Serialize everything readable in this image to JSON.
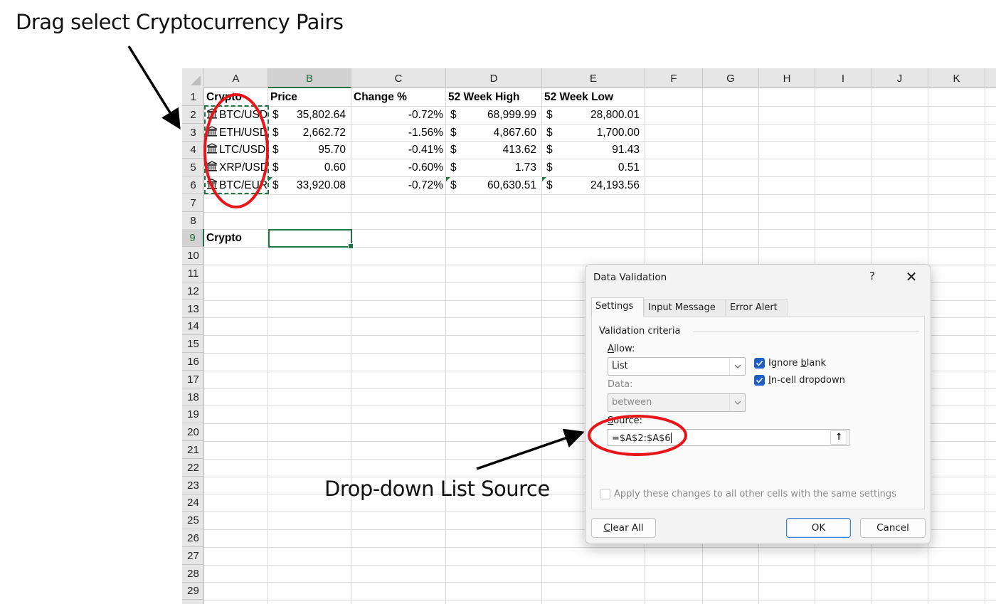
{
  "annotations": {
    "drag_select": "Drag select Cryptocurrency Pairs",
    "dropdown_source": "Drop-down List Source",
    "highlight_color": "#e8161b",
    "arrow_color": "#000000"
  },
  "sheet": {
    "columns": [
      "A",
      "B",
      "C",
      "D",
      "E",
      "F",
      "G",
      "H",
      "I",
      "J",
      "K"
    ],
    "active_column": "B",
    "active_row": "9",
    "rows": [
      "1",
      "2",
      "3",
      "4",
      "5",
      "6",
      "7",
      "8",
      "9",
      "10",
      "11",
      "12",
      "13",
      "14",
      "15",
      "16",
      "17",
      "18",
      "19",
      "20",
      "21",
      "22",
      "23",
      "24",
      "25",
      "26",
      "27",
      "28",
      "29"
    ],
    "headers": {
      "crypto": "Crypto",
      "price": "Price",
      "change": "Change %",
      "high": "52 Week High",
      "low": "52 Week Low"
    },
    "currency_symbol": "$",
    "data_type_icon": "bank-icon",
    "data": [
      {
        "pair": "BTC/USD",
        "price": "35,802.64",
        "change": "-0.72%",
        "high": "68,999.99",
        "low": "28,800.01"
      },
      {
        "pair": "ETH/USD",
        "price": "2,662.72",
        "change": "-1.56%",
        "high": "4,867.60",
        "low": "1,700.00"
      },
      {
        "pair": "LTC/USD",
        "price": "95.70",
        "change": "-0.41%",
        "high": "413.62",
        "low": "91.43"
      },
      {
        "pair": "XRP/USD",
        "price": "0.60",
        "change": "-0.60%",
        "high": "1.73",
        "low": "0.51"
      },
      {
        "pair": "BTC/EUR",
        "price": "33,920.08",
        "change": "-0.72%",
        "high": "60,630.51",
        "low": "24,193.56"
      }
    ],
    "a9_label": "Crypto",
    "selected_cell": "B9",
    "accent_color": "#217346"
  },
  "dialog": {
    "title": "Data Validation",
    "help": "?",
    "close": "✕",
    "tabs": [
      {
        "label": "Settings",
        "active": true
      },
      {
        "label": "Input Message",
        "active": false
      },
      {
        "label": "Error Alert",
        "active": false
      }
    ],
    "criteria_legend": "Validation criteria",
    "allow_label_key": "A",
    "allow_label_rest": "llow:",
    "allow_value": "List",
    "data_label": "Data:",
    "data_value": "between",
    "ignore_blank_pre": "Ignore ",
    "ignore_blank_key": "b",
    "ignore_blank_post": "lank",
    "ignore_blank_checked": true,
    "incell_key": "I",
    "incell_rest": "n-cell dropdown",
    "incell_checked": true,
    "source_label_key": "S",
    "source_label_rest": "ource:",
    "source_value": "=$A$2:$A$6",
    "collapse_icon": "⭡",
    "apply_all_label": "Apply these changes to all other cells with the same settings",
    "apply_all_checked": false,
    "clear_all_key": "C",
    "clear_all_rest": "lear All",
    "ok_label": "OK",
    "cancel_label": "Cancel",
    "checkbox_color": "#1f5fbf"
  }
}
